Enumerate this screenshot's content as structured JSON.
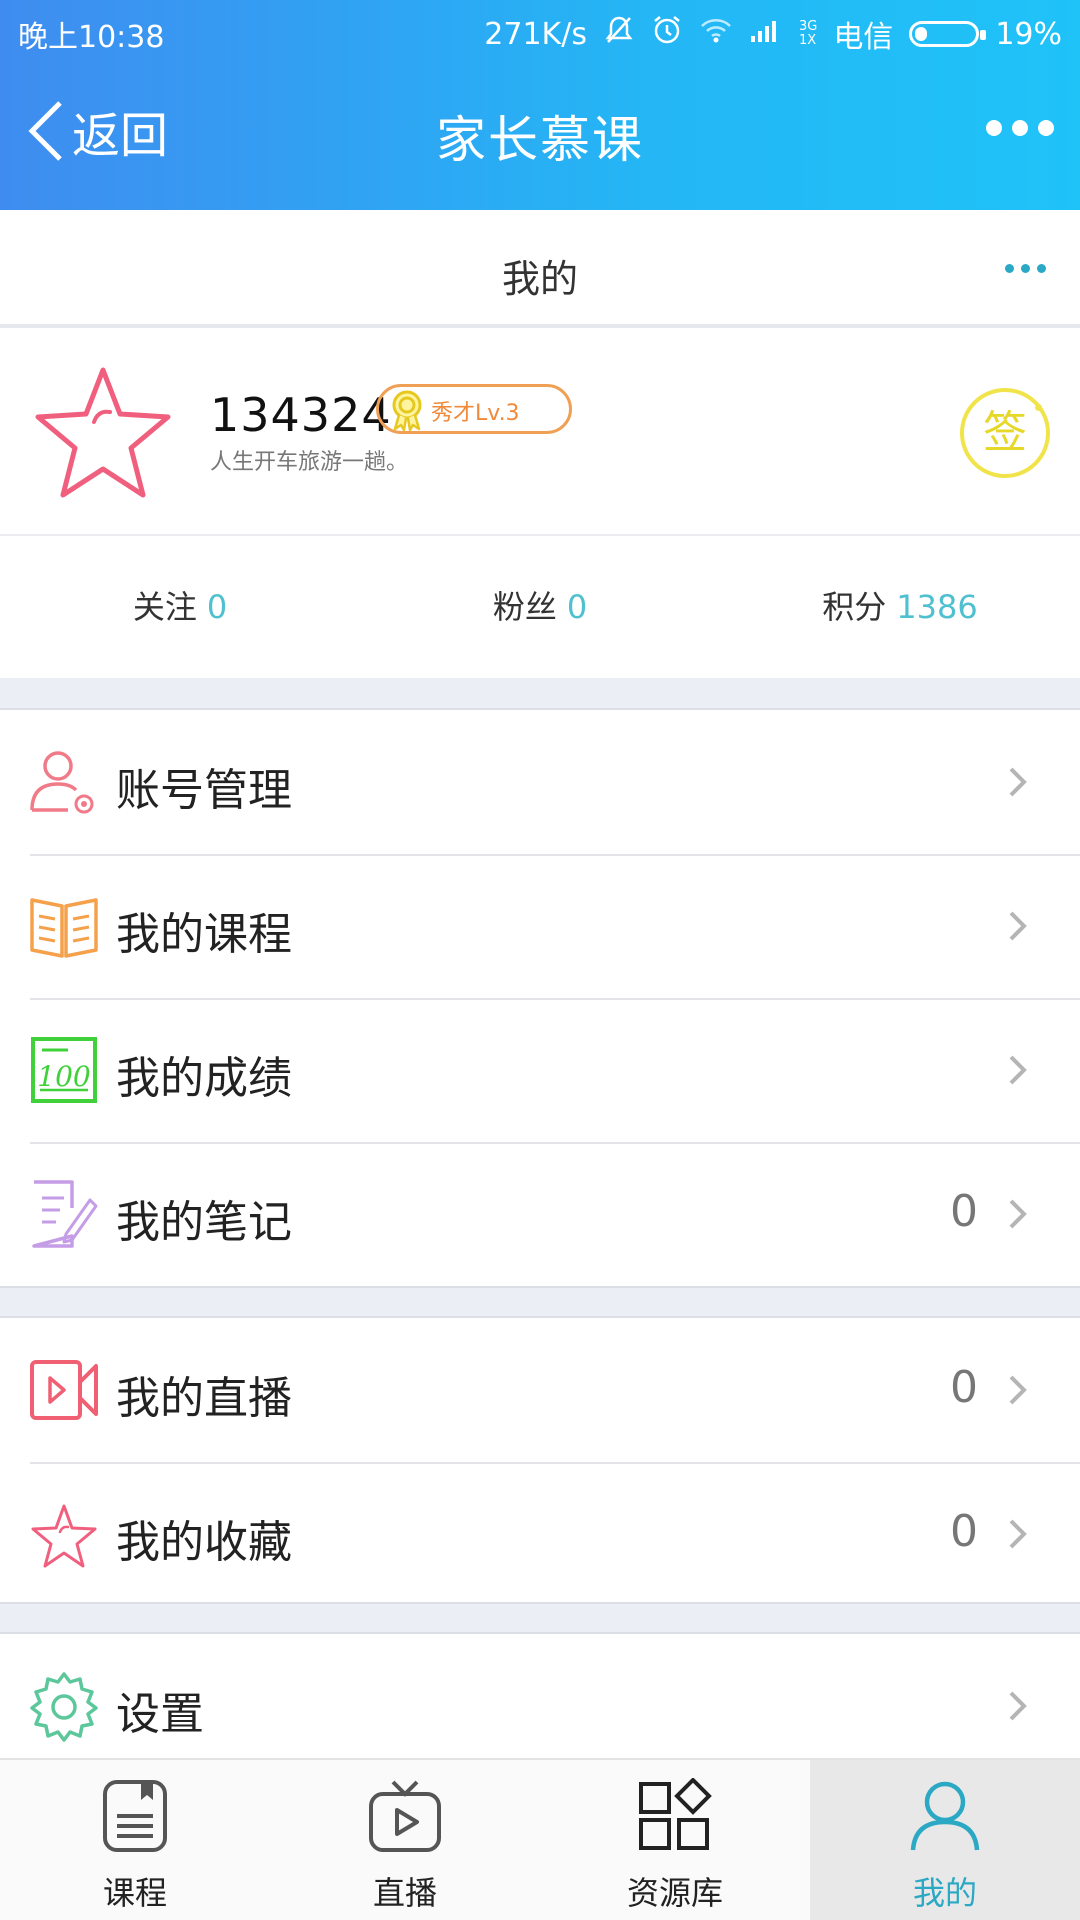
{
  "status_bar": {
    "time": "晚上10:38",
    "speed": "271K/s",
    "network_top": "3G",
    "network_bottom": "1X",
    "carrier": "电信",
    "battery": "19%"
  },
  "nav": {
    "back_label": "返回",
    "title": "家长慕课"
  },
  "subheader": {
    "title": "我的"
  },
  "profile": {
    "username": "134324",
    "badge": "秀才Lv.3",
    "motto": "人生开车旅游一趟。",
    "signin_label": "签"
  },
  "stats": [
    {
      "label": "关注",
      "value": "0"
    },
    {
      "label": "粉丝",
      "value": "0"
    },
    {
      "label": "积分",
      "value": "1386"
    }
  ],
  "menu": {
    "account": {
      "label": "账号管理"
    },
    "courses": {
      "label": "我的课程"
    },
    "grades": {
      "label": "我的成绩"
    },
    "notes": {
      "label": "我的笔记",
      "count": "0"
    },
    "live": {
      "label": "我的直播",
      "count": "0"
    },
    "favorites": {
      "label": "我的收藏",
      "count": "0"
    },
    "settings": {
      "label": "设置"
    }
  },
  "tabs": [
    {
      "label": "课程",
      "icon": "course-book-icon"
    },
    {
      "label": "直播",
      "icon": "tv-play-icon"
    },
    {
      "label": "资源库",
      "icon": "grid-diamond-icon"
    },
    {
      "label": "我的",
      "icon": "user-icon",
      "active": true
    }
  ],
  "colors": {
    "header_start": "#3f8cf0",
    "header_end": "#1fc3f8",
    "accent": "#2ba8c3",
    "stat_value": "#4fc0d0"
  }
}
